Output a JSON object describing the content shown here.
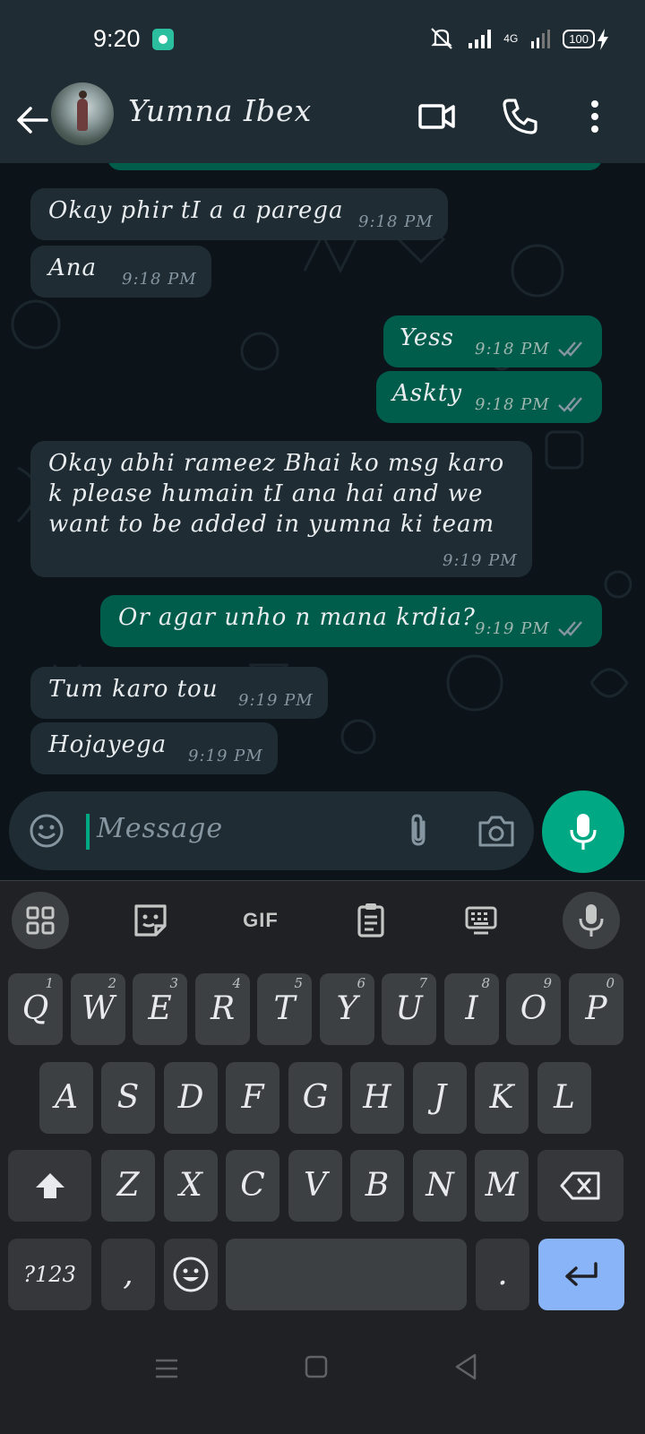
{
  "status": {
    "time": "9:20",
    "network": "4G",
    "battery": "100"
  },
  "header": {
    "contact_name": "Yumna Ibex",
    "icons": [
      "back-arrow-icon",
      "video-call-icon",
      "voice-call-icon",
      "more-options-icon"
    ]
  },
  "messages": [
    {
      "direction": "in",
      "text": "Okay phir tI a a parega",
      "time": "9:18 PM"
    },
    {
      "direction": "in",
      "text": "Ana",
      "time": "9:18 PM"
    },
    {
      "direction": "out",
      "text": "Yess",
      "time": "9:18 PM",
      "status": "read"
    },
    {
      "direction": "out",
      "text": "Askty",
      "time": "9:18 PM",
      "status": "read"
    },
    {
      "direction": "in",
      "text": "Okay abhi rameez Bhai ko msg karo k please humain tI ana hai and we want to be added in yumna ki team",
      "time": "9:19 PM"
    },
    {
      "direction": "out",
      "text": "Or agar unho n mana krdia?",
      "time": "9:19 PM",
      "status": "read"
    },
    {
      "direction": "in",
      "text": "Tum karo tou",
      "time": "9:19 PM"
    },
    {
      "direction": "in",
      "text": "Hojayega",
      "time": "9:19 PM"
    }
  ],
  "composer": {
    "placeholder": "Message"
  },
  "keyboard": {
    "toolbar": {
      "gif_label": "GIF"
    },
    "row1": [
      {
        "label": "Q",
        "hint": "1"
      },
      {
        "label": "W",
        "hint": "2"
      },
      {
        "label": "E",
        "hint": "3"
      },
      {
        "label": "R",
        "hint": "4"
      },
      {
        "label": "T",
        "hint": "5"
      },
      {
        "label": "Y",
        "hint": "6"
      },
      {
        "label": "U",
        "hint": "7"
      },
      {
        "label": "I",
        "hint": "8"
      },
      {
        "label": "O",
        "hint": "9"
      },
      {
        "label": "P",
        "hint": "0"
      }
    ],
    "row2": [
      "A",
      "S",
      "D",
      "F",
      "G",
      "H",
      "J",
      "K",
      "L"
    ],
    "row3": [
      "Z",
      "X",
      "C",
      "V",
      "B",
      "N",
      "M"
    ],
    "row4": {
      "symbols": "?123",
      "comma": ",",
      "period": "."
    }
  },
  "colors": {
    "header_bg": "#1f2c34",
    "chat_bg": "#0c141a",
    "incoming_bubble": "#1f2c34",
    "outgoing_bubble": "#005c4b",
    "accent": "#00a884",
    "read_ticks": "#8696a0",
    "enter_key": "#8ab4f8"
  }
}
